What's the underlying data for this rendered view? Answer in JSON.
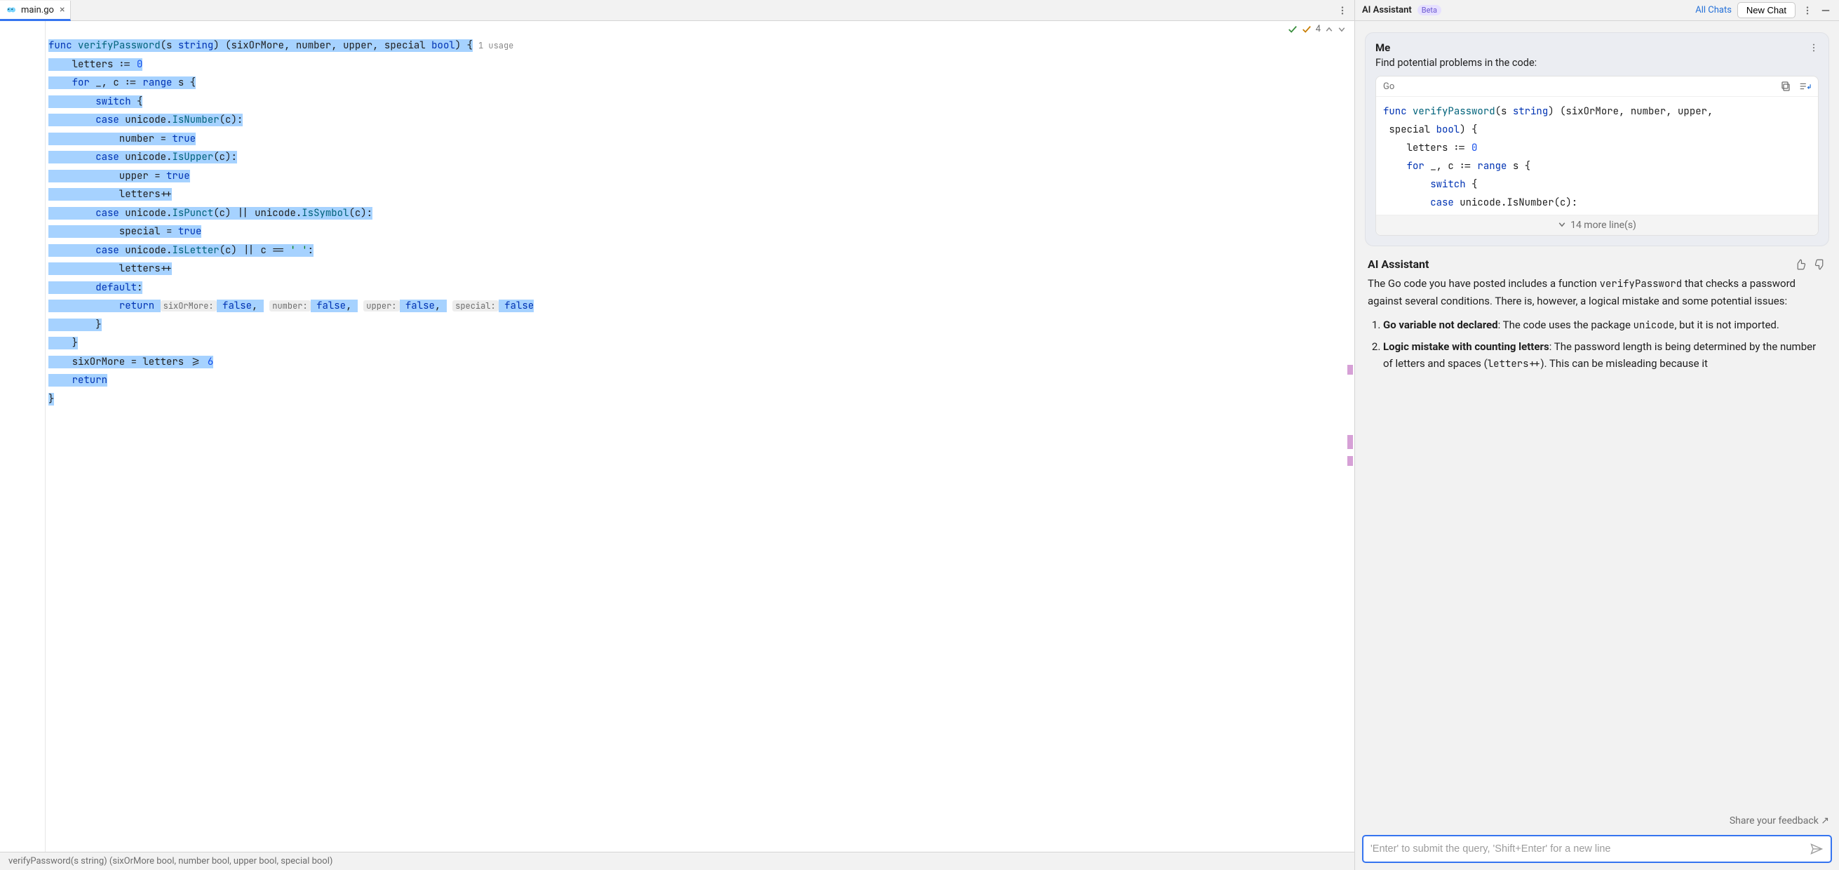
{
  "tab": {
    "filename": "main.go"
  },
  "inspections": {
    "count": "4"
  },
  "code": {
    "usages": "1 usage",
    "hints": {
      "sixOrMore": "sixOrMore:",
      "number": "number:",
      "upper": "upper:",
      "special": "special:"
    },
    "tok": {
      "func": "func",
      "fn_name": "verifyPassword",
      "lp": "(",
      "s": "s",
      "sp": " ",
      "string": "string",
      "rp": ")",
      "ret_lp": "(",
      "sixOrMore": "sixOrMore",
      "c1": ", ",
      "number": "number",
      "c2": ", ",
      "upper": "upper",
      "c3": ", ",
      "special": "special",
      "bool": "bool",
      "ret_rp": ")",
      "lb": " {",
      "letters_decl_a": "    letters := ",
      "zero": "0",
      "for": "for",
      "for_rest": " _, c := ",
      "range": "range",
      "for_s": " s {",
      "switch": "switch",
      "switch_lb": " {",
      "case": "case",
      "unicode": "unicode",
      "dot": ".",
      "isnumber": "IsNumber",
      "call_c": "(c):",
      "number_assign": "            number = ",
      "true": "true",
      "isupper": "IsUpper",
      "upper_assign": "            upper = ",
      "lettersinc": "            letters++",
      "ispunct": "IsPunct",
      "oror": "(c) || ",
      "issymbol": "IsSymbol",
      "special_assign": "            special = ",
      "isletter": "IsLetter",
      "or_c_sp": "(c) || c == ",
      "sq": "' '",
      "colon": ":",
      "default": "default",
      "def_colon": ":",
      "return": "return",
      "ret_sp": " ",
      "false": "false",
      "comma": ", ",
      "brace_close_8": "        }",
      "brace_close_4": "    }",
      "six_line_a": "    sixOrMore = letters >= ",
      "six": "6",
      "return2": "return",
      "final_brace": "}"
    }
  },
  "statusbar": {
    "breadcrumb": "verifyPassword(s string) (sixOrMore bool, number bool, upper bool, special bool)"
  },
  "ai": {
    "title": "AI Assistant",
    "beta": "Beta",
    "all_chats": "All Chats",
    "new_chat": "New Chat",
    "me": {
      "name": "Me",
      "text": "Find potential problems in the code:"
    },
    "snippet": {
      "lang": "Go",
      "more": "14 more line(s)",
      "tok": {
        "func": "func",
        "fn": "verifyPassword",
        "sig_a": "(s ",
        "string": "string",
        "sig_b": ") (sixOrMore, number, upper,",
        "line2_a": " special ",
        "bool": "bool",
        "line2_b": ") {",
        "letters_a": "    letters := ",
        "zero": "0",
        "for": "for",
        "for_rest": " _, c := ",
        "range": "range",
        "for_s": " s {",
        "switch": "switch",
        "switch_lb": " {",
        "case": "case",
        "case_rest": " unicode.IsNumber(c):"
      }
    },
    "assistant": {
      "name": "AI Assistant",
      "para_a": "The Go code you have posted includes a function ",
      "para_code": "verifyPassword",
      "para_b": " that checks a password against several conditions. There is, however, a logical mistake and some potential issues:",
      "item1_lead": "Go variable not declared",
      "item1_rest_a": ": The code uses the package ",
      "item1_code": "unicode",
      "item1_rest_b": ", but it is not imported.",
      "item2_lead": "Logic mistake with counting letters",
      "item2_rest_a": ": The password length is being determined by the number of letters and spaces (",
      "item2_code": "letters++",
      "item2_rest_b": "). This can be misleading because it"
    },
    "feedback": "Share your feedback ↗",
    "input_placeholder": "'Enter' to submit the query, 'Shift+Enter' for a new line"
  }
}
